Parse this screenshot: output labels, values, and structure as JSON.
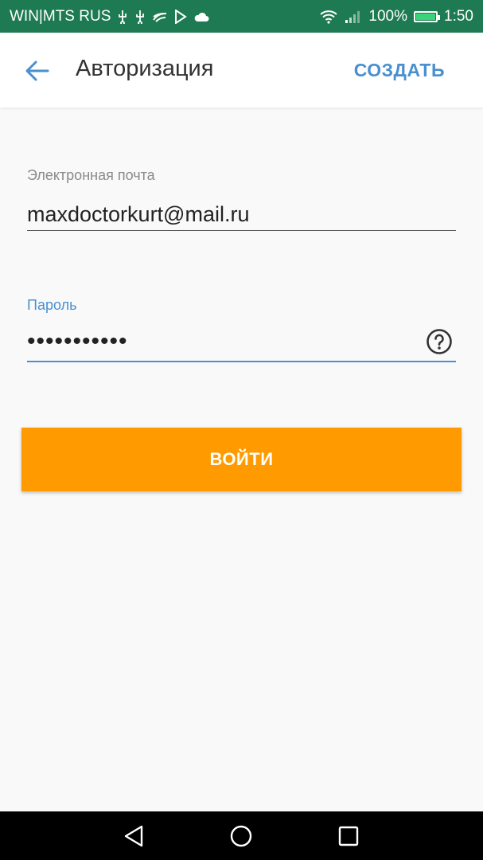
{
  "status_bar": {
    "carrier": "WIN|MTS RUS",
    "battery_percent": "100%",
    "time": "1:50",
    "background": "#1e7a52",
    "left_icons": [
      "usb-icon",
      "usb-icon",
      "swiftkey-icon",
      "play-store-icon",
      "cloud-icon"
    ],
    "right_icons": [
      "wifi-icon",
      "signal-icon",
      "battery-charging-icon"
    ]
  },
  "toolbar": {
    "back_icon": "arrow-left-icon",
    "title": "Авторизация",
    "create_label": "СОЗДАТЬ",
    "accent": "#4a8fd0"
  },
  "form": {
    "email_label": "Электронная почта",
    "email_value": "maxdoctorkurt@mail.ru",
    "password_label": "Пароль",
    "password_masked": "•••••••••••",
    "help_icon": "question-circle-icon"
  },
  "login_button": {
    "label": "ВОЙТИ",
    "color": "#ff9b00"
  },
  "nav_bar": {
    "buttons": [
      "triangle-back-icon",
      "circle-home-icon",
      "square-recents-icon"
    ]
  }
}
